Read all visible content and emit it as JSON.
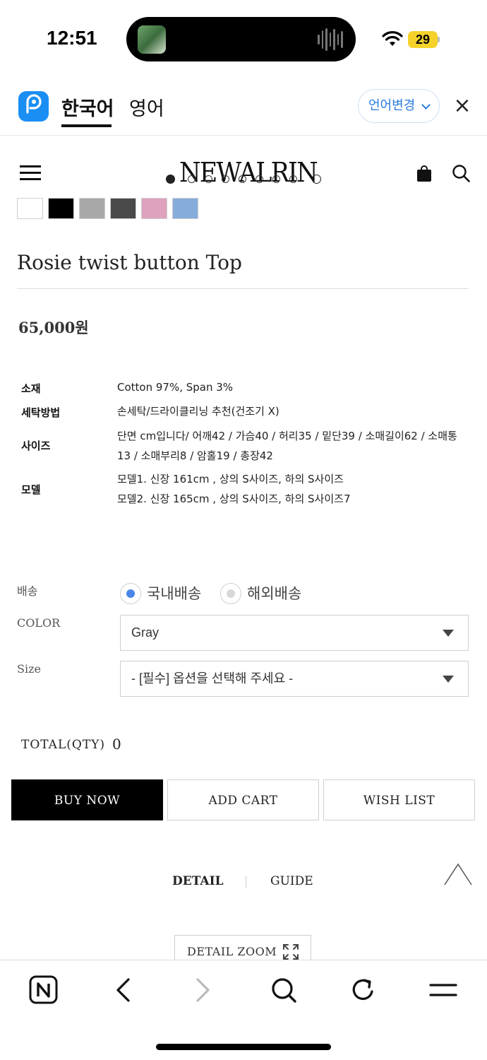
{
  "status_bar": {
    "time": "12:51",
    "battery": "29"
  },
  "translate_bar": {
    "languages": [
      "한국어",
      "영어"
    ],
    "change_language_label": "언어변경",
    "close_symbol": "×"
  },
  "site_header": {
    "logo_text": "NEWALRIN"
  },
  "product": {
    "color_swatches": [
      "#ffffff",
      "#000000",
      "#a8a8a8",
      "#4a4a4a",
      "#dea2be",
      "#86acdc"
    ],
    "title": "Rosie twist button Top",
    "price": "65,000원",
    "specs": [
      {
        "label": "소재",
        "value": "Cotton 97%, Span 3%"
      },
      {
        "label": "세탁방법",
        "value": "손세탁/드라이클리닝 추천(건조기 X)"
      },
      {
        "label": "사이즈",
        "value": "단면 cm입니다/ 어깨42 / 가슴40 / 허리35 / 밑단39 /  소매길이62 / 소매통13 / 소매부리8 / 암홀19 / 총장42"
      },
      {
        "label": "모델",
        "value_lines": [
          "모델1. 신장 161cm , 상의 S사이즈, 하의 S사이즈",
          "모델2. 신장 165cm , 상의 S사이즈, 하의 S사이즈7"
        ]
      }
    ]
  },
  "options": {
    "shipping_label": "배송",
    "shipping_choices": [
      "국내배송",
      "해외배송"
    ],
    "shipping_selected": "국내배송",
    "color_label": "COLOR",
    "color_value": "Gray",
    "size_label": "Size",
    "size_value": "- [필수] 옵션을 선택해 주세요 -"
  },
  "total": {
    "label": "TOTAL(QTY)",
    "value": "0"
  },
  "actions": {
    "buy": "BUY NOW",
    "cart": "ADD CART",
    "wish": "WISH LIST"
  },
  "detail_tabs": {
    "detail": "DETAIL",
    "guide": "GUIDE"
  },
  "zoom_button": "DETAIL ZOOM",
  "colors": {
    "accent_blue": "#2a7be0",
    "radio_selected": "#4a86e8",
    "battery": "#f5d22a"
  },
  "toolbar_icons": [
    "naver-n-icon",
    "back-icon",
    "forward-icon",
    "search-icon",
    "refresh-icon",
    "menu-icon"
  ]
}
